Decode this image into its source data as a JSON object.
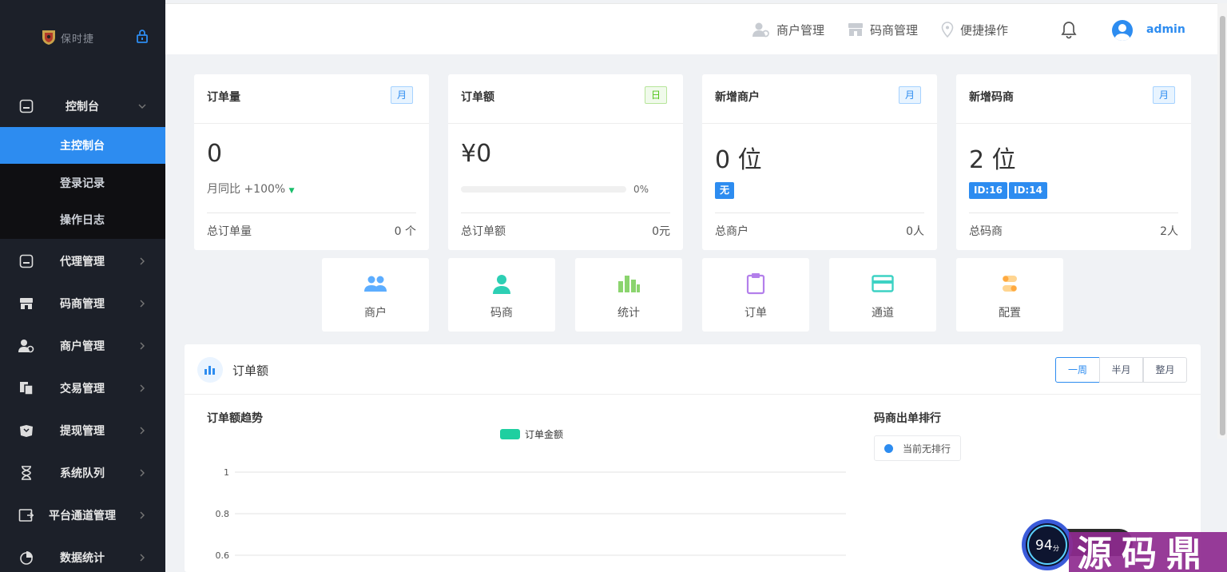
{
  "sidebar": {
    "logo_text": "保时捷",
    "console": {
      "label": "控制台"
    },
    "submenu": [
      {
        "label": "主控制台",
        "active": true
      },
      {
        "label": "登录记录",
        "active": false
      },
      {
        "label": "操作日志",
        "active": false
      }
    ],
    "items": [
      {
        "label": "代理管理",
        "icon": "agent-icon"
      },
      {
        "label": "码商管理",
        "icon": "store-icon"
      },
      {
        "label": "商户管理",
        "icon": "merchant-icon"
      },
      {
        "label": "交易管理",
        "icon": "transaction-icon"
      },
      {
        "label": "提现管理",
        "icon": "withdraw-icon"
      },
      {
        "label": "系统队列",
        "icon": "hourglass-icon"
      },
      {
        "label": "平台通道管理",
        "icon": "channel-icon"
      },
      {
        "label": "数据统计",
        "icon": "pie-chart-icon"
      }
    ]
  },
  "header": {
    "nav": [
      {
        "label": "商户管理",
        "icon": "merchant-icon"
      },
      {
        "label": "码商管理",
        "icon": "store-icon"
      },
      {
        "label": "便捷操作",
        "icon": "location-icon"
      }
    ],
    "user": "admin"
  },
  "cards": [
    {
      "title": "订单量",
      "tag": "月",
      "value": "0",
      "sub": "月同比 +100%",
      "foot_label": "总订单量",
      "foot_value": "0 个"
    },
    {
      "title": "订单额",
      "tag": "日",
      "value": "¥0",
      "progress_pct": "0%",
      "progress": 0,
      "foot_label": "总订单额",
      "foot_value": "0元"
    },
    {
      "title": "新增商户",
      "tag": "月",
      "value": "0 位",
      "badges": [
        "无"
      ],
      "foot_label": "总商户",
      "foot_value": "0人"
    },
    {
      "title": "新增码商",
      "tag": "月",
      "value": "2 位",
      "badges": [
        "ID:16",
        "ID:14"
      ],
      "foot_label": "总码商",
      "foot_value": "2人"
    }
  ],
  "quick": [
    {
      "label": "商户",
      "color": "#5cadff"
    },
    {
      "label": "码商",
      "color": "#2dcfb4"
    },
    {
      "label": "统计",
      "color": "#8bd46e"
    },
    {
      "label": "订单",
      "color": "#b37feb"
    },
    {
      "label": "通道",
      "color": "#3dd2c4"
    },
    {
      "label": "配置",
      "color": "#ffb050"
    }
  ],
  "panel": {
    "title": "订单额",
    "ranges": [
      "一周",
      "半月",
      "整月"
    ],
    "active_range": "一周",
    "chart_title": "订单额趋势",
    "rank_title": "码商出单排行",
    "rank_empty": "当前无排行"
  },
  "chart_data": {
    "type": "area",
    "series": [
      {
        "name": "订单金额",
        "values": []
      }
    ],
    "y_ticks": [
      "1",
      "0.8",
      "0.6"
    ],
    "ylim": [
      0,
      1
    ],
    "grid": true,
    "legend": "top-center"
  },
  "watermark": {
    "score": "94",
    "score_unit": "分",
    "text": "源码鼎"
  }
}
